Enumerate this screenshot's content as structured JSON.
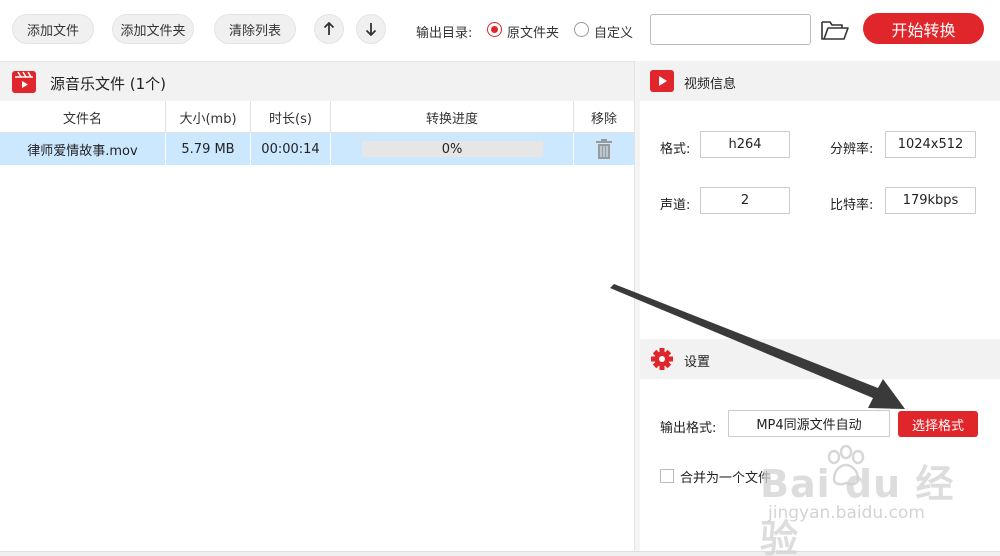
{
  "toolbar": {
    "add_file": "添加文件",
    "add_folder": "添加文件夹",
    "clear_list": "清除列表",
    "output_dir_label": "输出目录:",
    "option_source": "原文件夹",
    "option_custom": "自定义",
    "output_path_value": "",
    "start_button": "开始转换"
  },
  "file_panel": {
    "title": "源音乐文件 (1个)",
    "columns": [
      "文件名",
      "大小(mb)",
      "时长(s)",
      "转换进度",
      "移除"
    ],
    "rows": [
      {
        "name": "律师爱情故事.mov",
        "size": "5.79 MB",
        "duration": "00:00:14",
        "progress_text": "0%",
        "progress_fraction": 0
      }
    ]
  },
  "video_info": {
    "title": "视频信息",
    "format_label": "格式:",
    "format_value": "h264",
    "resolution_label": "分辨率:",
    "resolution_value": "1024x512",
    "channel_label": "声道:",
    "channel_value": "2",
    "bitrate_label": "比特率:",
    "bitrate_value": "179kbps"
  },
  "settings": {
    "title": "设置",
    "output_format_label": "输出格式:",
    "output_format_value": "MP4同源文件自动",
    "select_format_button": "选择格式",
    "merge_label": "合并为一个文件",
    "merge_checked": false
  },
  "watermark": {
    "main": "Bai du 经验",
    "sub": "jingyan.baidu.com"
  },
  "colors": {
    "accent": "#e0252b",
    "row_selected": "#cce8ff"
  },
  "icons": [
    "arrow-up-icon",
    "arrow-down-icon",
    "folder-open-icon",
    "music-file-icon",
    "trash-icon",
    "video-play-icon",
    "gear-icon",
    "annotation-arrow"
  ]
}
